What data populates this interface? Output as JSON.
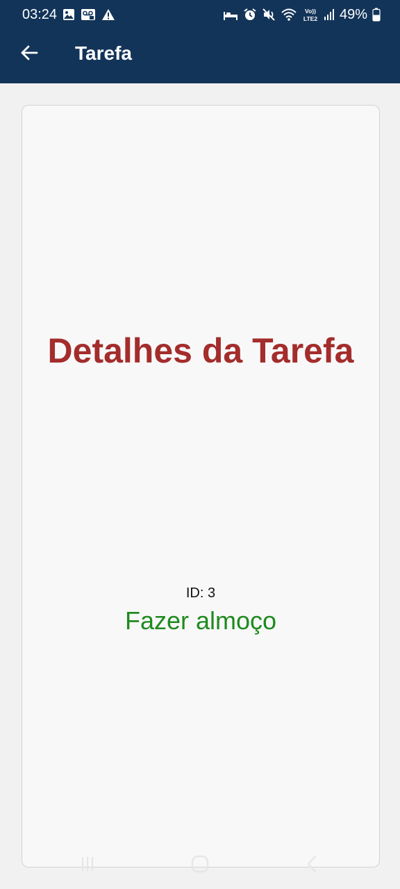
{
  "status_bar": {
    "time": "03:24",
    "battery": "49%",
    "icons_left": [
      "image-icon",
      "voicemail-icon",
      "warning-icon"
    ],
    "icons_right": [
      "sleep-mode-icon",
      "alarm-icon",
      "mute-icon",
      "wifi-icon",
      "volte-lte2-icon",
      "signal-icon",
      "battery-icon"
    ],
    "network_label_top": "Vo))",
    "network_label_bottom": "LTE2"
  },
  "app_bar": {
    "title": "Tarefa",
    "back_icon": "arrow-left-icon",
    "background_color": "#133459"
  },
  "card": {
    "heading": "Detalhes da Tarefa",
    "heading_color": "#a32d2c",
    "id_text": "ID: 3",
    "task_name": "Fazer almoço",
    "task_color": "#1e8a1e"
  },
  "nav_bar": {
    "buttons": [
      "recents-icon",
      "home-icon",
      "back-icon"
    ]
  }
}
